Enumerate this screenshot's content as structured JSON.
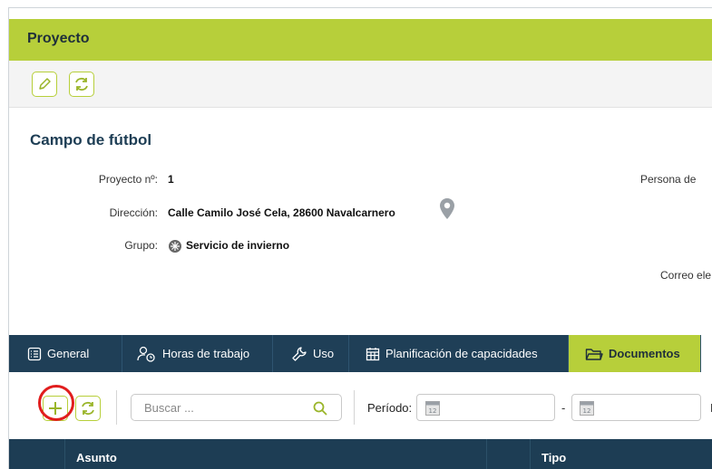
{
  "header": {
    "title": "Proyecto"
  },
  "toolbar": {
    "edit_icon": "pencil-icon",
    "refresh_icon": "refresh-icon"
  },
  "project": {
    "name": "Campo de fútbol",
    "fields": {
      "number_label": "Proyecto nº:",
      "number_value": "1",
      "address_label": "Dirección:",
      "address_value": "Calle Camilo José Cela, 28600 Navalcarnero",
      "group_label": "Grupo:",
      "group_value": "Servicio de invierno"
    },
    "right_labels": {
      "contact_person": "Persona de",
      "email": "Correo ele"
    }
  },
  "tabs": [
    {
      "label": "General",
      "icon": "list-icon"
    },
    {
      "label": "Horas de trabajo",
      "icon": "person-clock-icon"
    },
    {
      "label": "Uso",
      "icon": "wrench-icon"
    },
    {
      "label": "Planificación de capacidades",
      "icon": "calendar-grid-icon"
    },
    {
      "label": "Documentos",
      "icon": "folder-icon",
      "active": true
    }
  ],
  "filters": {
    "search_placeholder": "Buscar ...",
    "period_label": "Período:",
    "date_separator": "-",
    "cut_label": "D"
  },
  "table": {
    "columns": [
      "Asunto",
      "Tipo"
    ]
  },
  "colors": {
    "accent": "#b7cf3a",
    "navy": "#1d3d54",
    "highlight": "#e11d1d"
  }
}
